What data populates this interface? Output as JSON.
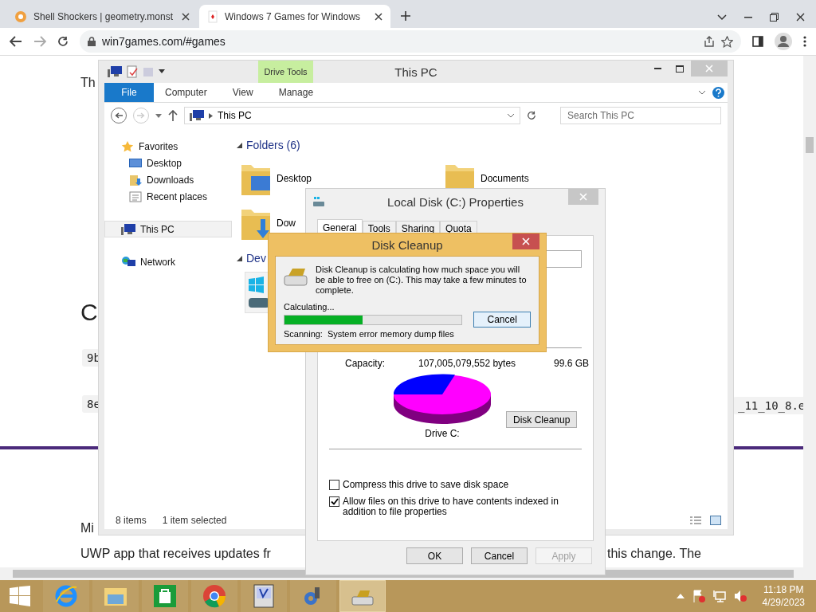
{
  "browser": {
    "tabs": [
      {
        "title": "Shell Shockers | geometry.monst",
        "selected": false
      },
      {
        "title": "Windows 7 Games for Windows",
        "selected": true
      }
    ],
    "url": "win7games.com/#games"
  },
  "webpage": {
    "fragments": [
      {
        "kind": "text",
        "text": "Th"
      },
      {
        "kind": "heading",
        "text": "C"
      },
      {
        "kind": "code",
        "text": "9b"
      },
      {
        "kind": "code",
        "text": "8e"
      },
      {
        "kind": "code",
        "text": "_11_10_8.e"
      },
      {
        "kind": "text",
        "text": "Mi"
      },
      {
        "kind": "text",
        "text": "UWP app that receives updates fr"
      },
      {
        "kind": "text",
        "text": "this change. The"
      }
    ]
  },
  "explorer": {
    "title": "This PC",
    "context_tab": "Drive Tools",
    "ribbon_tabs": [
      {
        "label": "File",
        "kind": "file"
      },
      {
        "label": "Computer",
        "kind": "tab"
      },
      {
        "label": "View",
        "kind": "tab"
      },
      {
        "label": "Manage",
        "kind": "tab"
      }
    ],
    "address": "This PC",
    "search": {
      "placeholder": "Search This PC"
    },
    "nav": [
      {
        "label": "Favorites",
        "kind": "star",
        "selected": false,
        "children": [
          {
            "label": "Desktop",
            "kind": "desktop",
            "selected": false
          },
          {
            "label": "Downloads",
            "kind": "downloads",
            "selected": false
          },
          {
            "label": "Recent places",
            "kind": "recent",
            "selected": false
          }
        ]
      },
      {
        "label": "This PC",
        "kind": "pc",
        "selected": true
      },
      {
        "label": "Network",
        "kind": "network",
        "selected": false
      }
    ],
    "folders_header": "Folders (6)",
    "folders": [
      {
        "name": "Desktop"
      },
      {
        "name": "Documents"
      },
      {
        "name": "Dow"
      }
    ],
    "devices_header": "Dev",
    "status": {
      "count": "8 items",
      "selection": "1 item selected"
    }
  },
  "properties": {
    "title": "Local Disk (C:) Properties",
    "tabs": [
      {
        "label": "General",
        "selected": true
      },
      {
        "label": "Tools",
        "selected": false
      },
      {
        "label": "Sharing",
        "selected": false
      },
      {
        "label": "Quota",
        "selected": false
      }
    ],
    "capacity": {
      "label": "Capacity:",
      "bytes": "107,005,079,552 bytes",
      "size": "99.6 GB"
    },
    "drive_label": "Drive C:",
    "cleanup_button": "Disk Cleanup",
    "options": [
      {
        "label": "Compress this drive to save disk space",
        "checked": false
      },
      {
        "label": "Allow files on this drive to have contents indexed in addition to file properties",
        "checked": true
      }
    ],
    "buttons": [
      {
        "label": "OK",
        "disabled": false
      },
      {
        "label": "Cancel",
        "disabled": false
      },
      {
        "label": "Apply",
        "disabled": true
      }
    ]
  },
  "disk_cleanup": {
    "title": "Disk Cleanup",
    "message": "Disk Cleanup is calculating how much space you will be able to free on  (C:). This may take a few minutes to complete.",
    "status": "Calculating...",
    "progress": {
      "level": 0.44
    },
    "scanning_label": "Scanning:",
    "scanning_item": "System error memory dump files",
    "cancel": "Cancel"
  },
  "taskbar": {
    "apps": [
      {
        "kind": "ie",
        "active": false
      },
      {
        "kind": "explorer",
        "active": false
      },
      {
        "kind": "store",
        "active": false
      },
      {
        "kind": "chrome",
        "active": false
      },
      {
        "kind": "app",
        "active": false
      },
      {
        "kind": "tool",
        "active": false
      },
      {
        "kind": "cleanup",
        "active": true
      }
    ],
    "time": "11:18 PM",
    "date": "4/29/2023"
  }
}
